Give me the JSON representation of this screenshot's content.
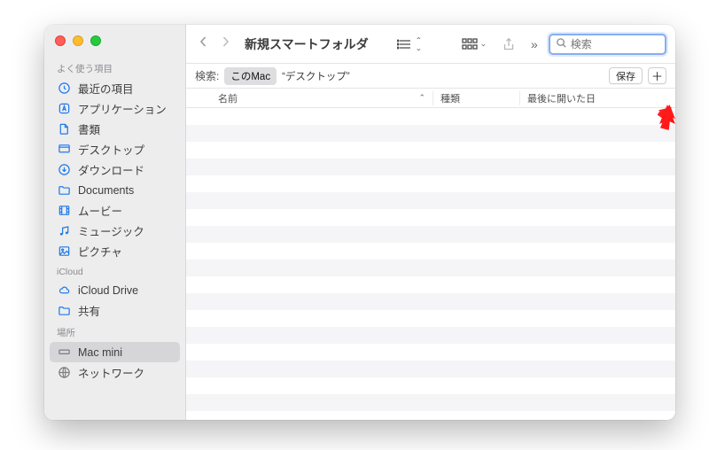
{
  "window_title": "新規スマートフォルダ",
  "search": {
    "placeholder": "検索"
  },
  "scope": {
    "label": "検索:",
    "selected": "このMac",
    "alt": "“デスクトップ”",
    "save": "保存"
  },
  "columns": {
    "name": "名前",
    "kind": "種類",
    "date": "最後に開いた日"
  },
  "sidebar": {
    "sections": [
      {
        "label": "よく使う項目",
        "items": [
          {
            "icon": "clock-icon",
            "label": "最近の項目"
          },
          {
            "icon": "app-icon",
            "label": "アプリケーション"
          },
          {
            "icon": "doc-icon",
            "label": "書類"
          },
          {
            "icon": "desktop-icon",
            "label": "デスクトップ"
          },
          {
            "icon": "download-icon",
            "label": "ダウンロード"
          },
          {
            "icon": "folder-icon",
            "label": "Documents"
          },
          {
            "icon": "movie-icon",
            "label": "ムービー"
          },
          {
            "icon": "music-icon",
            "label": "ミュージック"
          },
          {
            "icon": "picture-icon",
            "label": "ピクチャ"
          }
        ]
      },
      {
        "label": "iCloud",
        "items": [
          {
            "icon": "cloud-icon",
            "label": "iCloud Drive"
          },
          {
            "icon": "shared-folder-icon",
            "label": "共有"
          }
        ]
      },
      {
        "label": "場所",
        "items": [
          {
            "icon": "computer-icon",
            "label": "Mac mini",
            "selected": true
          },
          {
            "icon": "network-icon",
            "label": "ネットワーク"
          }
        ]
      }
    ]
  }
}
